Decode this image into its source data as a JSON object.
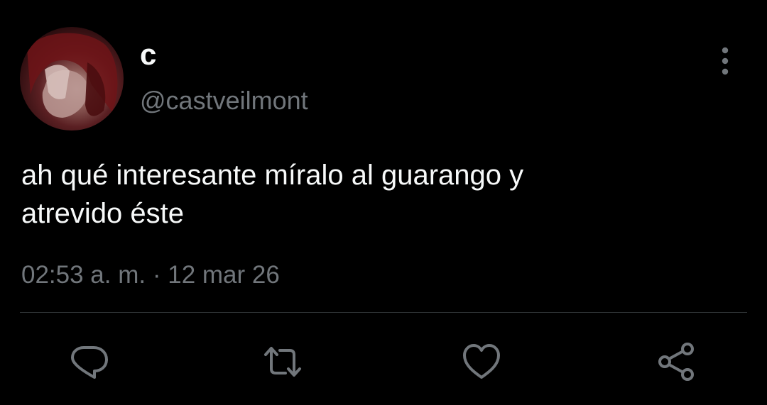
{
  "tweet": {
    "author": {
      "display_name": "c",
      "handle": "@castveilmont",
      "avatar_icon": "avatar-photo"
    },
    "text": "ah qué interesante míralo al guarango y\natrevido éste",
    "time": "02:53 a. m.",
    "separator": "·",
    "date": "12 mar 26",
    "actions": {
      "reply_icon": "reply-icon",
      "retweet_icon": "retweet-icon",
      "like_icon": "like-icon",
      "share_icon": "share-icon",
      "more_icon": "more-vertical-icon"
    }
  },
  "colors": {
    "background": "#000000",
    "primary_text": "#f7f9f9",
    "secondary_text": "#71767b",
    "divider": "#2f3336"
  }
}
